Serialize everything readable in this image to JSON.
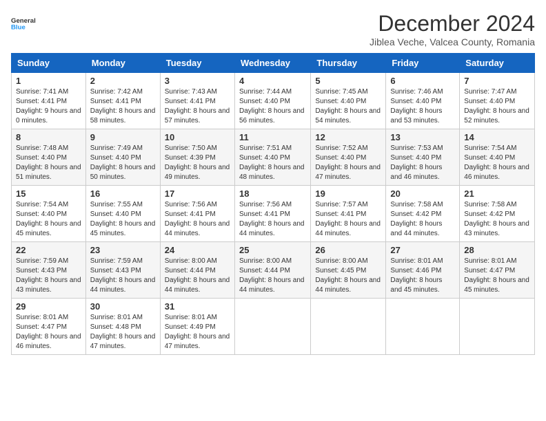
{
  "logo": {
    "line1": "General",
    "line2": "Blue"
  },
  "title": "December 2024",
  "subtitle": "Jiblea Veche, Valcea County, Romania",
  "days_of_week": [
    "Sunday",
    "Monday",
    "Tuesday",
    "Wednesday",
    "Thursday",
    "Friday",
    "Saturday"
  ],
  "weeks": [
    [
      {
        "day": "1",
        "sunrise": "7:41 AM",
        "sunset": "4:41 PM",
        "daylight": "9 hours and 0 minutes."
      },
      {
        "day": "2",
        "sunrise": "7:42 AM",
        "sunset": "4:41 PM",
        "daylight": "8 hours and 58 minutes."
      },
      {
        "day": "3",
        "sunrise": "7:43 AM",
        "sunset": "4:41 PM",
        "daylight": "8 hours and 57 minutes."
      },
      {
        "day": "4",
        "sunrise": "7:44 AM",
        "sunset": "4:40 PM",
        "daylight": "8 hours and 56 minutes."
      },
      {
        "day": "5",
        "sunrise": "7:45 AM",
        "sunset": "4:40 PM",
        "daylight": "8 hours and 54 minutes."
      },
      {
        "day": "6",
        "sunrise": "7:46 AM",
        "sunset": "4:40 PM",
        "daylight": "8 hours and 53 minutes."
      },
      {
        "day": "7",
        "sunrise": "7:47 AM",
        "sunset": "4:40 PM",
        "daylight": "8 hours and 52 minutes."
      }
    ],
    [
      {
        "day": "8",
        "sunrise": "7:48 AM",
        "sunset": "4:40 PM",
        "daylight": "8 hours and 51 minutes."
      },
      {
        "day": "9",
        "sunrise": "7:49 AM",
        "sunset": "4:40 PM",
        "daylight": "8 hours and 50 minutes."
      },
      {
        "day": "10",
        "sunrise": "7:50 AM",
        "sunset": "4:39 PM",
        "daylight": "8 hours and 49 minutes."
      },
      {
        "day": "11",
        "sunrise": "7:51 AM",
        "sunset": "4:40 PM",
        "daylight": "8 hours and 48 minutes."
      },
      {
        "day": "12",
        "sunrise": "7:52 AM",
        "sunset": "4:40 PM",
        "daylight": "8 hours and 47 minutes."
      },
      {
        "day": "13",
        "sunrise": "7:53 AM",
        "sunset": "4:40 PM",
        "daylight": "8 hours and 46 minutes."
      },
      {
        "day": "14",
        "sunrise": "7:54 AM",
        "sunset": "4:40 PM",
        "daylight": "8 hours and 46 minutes."
      }
    ],
    [
      {
        "day": "15",
        "sunrise": "7:54 AM",
        "sunset": "4:40 PM",
        "daylight": "8 hours and 45 minutes."
      },
      {
        "day": "16",
        "sunrise": "7:55 AM",
        "sunset": "4:40 PM",
        "daylight": "8 hours and 45 minutes."
      },
      {
        "day": "17",
        "sunrise": "7:56 AM",
        "sunset": "4:41 PM",
        "daylight": "8 hours and 44 minutes."
      },
      {
        "day": "18",
        "sunrise": "7:56 AM",
        "sunset": "4:41 PM",
        "daylight": "8 hours and 44 minutes."
      },
      {
        "day": "19",
        "sunrise": "7:57 AM",
        "sunset": "4:41 PM",
        "daylight": "8 hours and 44 minutes."
      },
      {
        "day": "20",
        "sunrise": "7:58 AM",
        "sunset": "4:42 PM",
        "daylight": "8 hours and 44 minutes."
      },
      {
        "day": "21",
        "sunrise": "7:58 AM",
        "sunset": "4:42 PM",
        "daylight": "8 hours and 43 minutes."
      }
    ],
    [
      {
        "day": "22",
        "sunrise": "7:59 AM",
        "sunset": "4:43 PM",
        "daylight": "8 hours and 43 minutes."
      },
      {
        "day": "23",
        "sunrise": "7:59 AM",
        "sunset": "4:43 PM",
        "daylight": "8 hours and 44 minutes."
      },
      {
        "day": "24",
        "sunrise": "8:00 AM",
        "sunset": "4:44 PM",
        "daylight": "8 hours and 44 minutes."
      },
      {
        "day": "25",
        "sunrise": "8:00 AM",
        "sunset": "4:44 PM",
        "daylight": "8 hours and 44 minutes."
      },
      {
        "day": "26",
        "sunrise": "8:00 AM",
        "sunset": "4:45 PM",
        "daylight": "8 hours and 44 minutes."
      },
      {
        "day": "27",
        "sunrise": "8:01 AM",
        "sunset": "4:46 PM",
        "daylight": "8 hours and 45 minutes."
      },
      {
        "day": "28",
        "sunrise": "8:01 AM",
        "sunset": "4:47 PM",
        "daylight": "8 hours and 45 minutes."
      }
    ],
    [
      {
        "day": "29",
        "sunrise": "8:01 AM",
        "sunset": "4:47 PM",
        "daylight": "8 hours and 46 minutes."
      },
      {
        "day": "30",
        "sunrise": "8:01 AM",
        "sunset": "4:48 PM",
        "daylight": "8 hours and 47 minutes."
      },
      {
        "day": "31",
        "sunrise": "8:01 AM",
        "sunset": "4:49 PM",
        "daylight": "8 hours and 47 minutes."
      },
      null,
      null,
      null,
      null
    ]
  ]
}
